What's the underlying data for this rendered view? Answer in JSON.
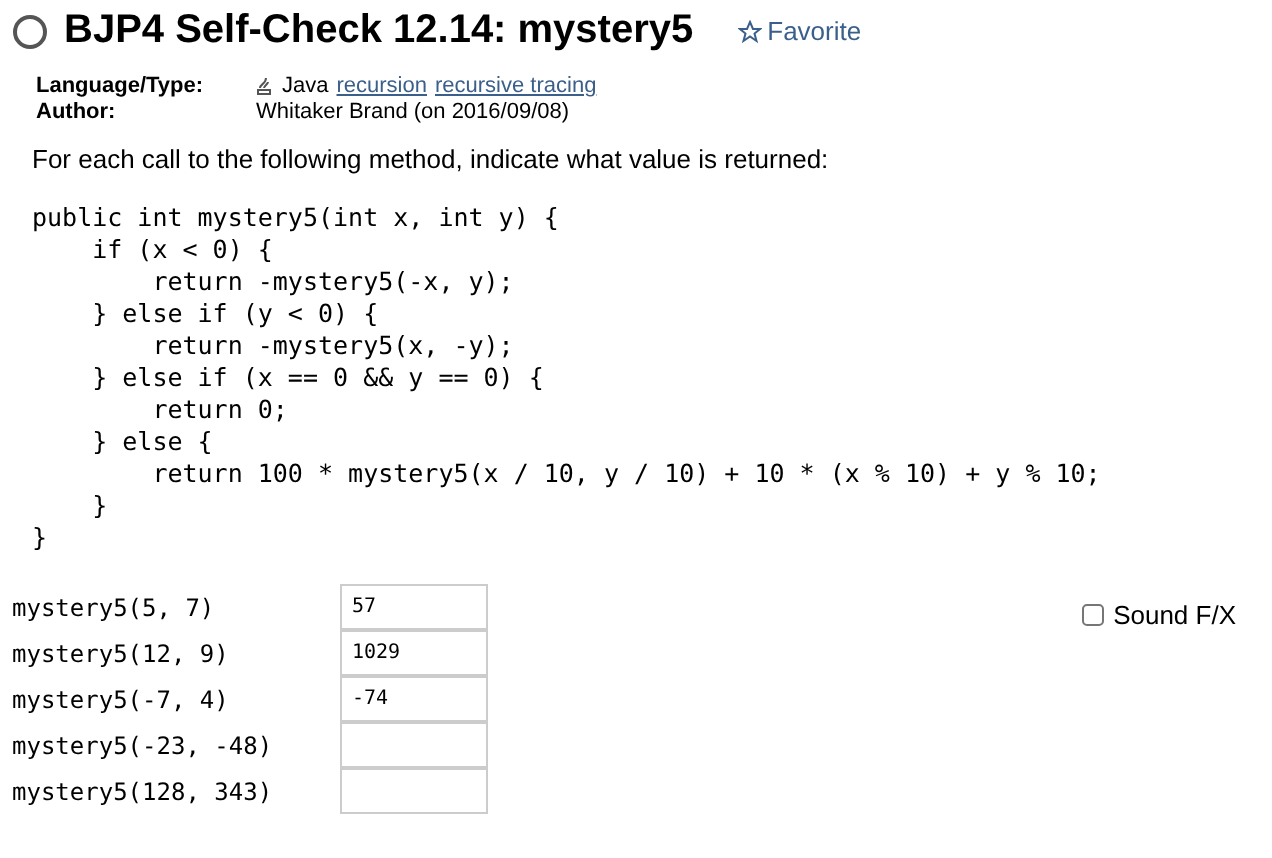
{
  "header": {
    "title": "BJP4 Self-Check 12.14: mystery5",
    "favorite": "Favorite"
  },
  "meta": [
    {
      "label": "Language/Type:",
      "value": "Java",
      "links": [
        "recursion",
        "recursive tracing"
      ]
    },
    {
      "label": "Author:",
      "value": "Whitaker Brand (on 2016/09/08)"
    }
  ],
  "prompt": "For each call to the following method, indicate what value is returned:",
  "code_lines": [
    "public int mystery5(int x, int y) {",
    "    if (x < 0) {",
    "        return -mystery5(-x, y);",
    "    } else if (y < 0) {",
    "        return -mystery5(x, -y);",
    "    } else if (x == 0 && y == 0) {",
    "        return 0;",
    "    } else {",
    "        return 100 * mystery5(x / 10, y / 10) + 10 * (x % 10) + y % 10;",
    "    }",
    "}"
  ],
  "questions": [
    {
      "call": "mystery5(5, 7)",
      "answer": "57"
    },
    {
      "call": "mystery5(12, 9)",
      "answer": "1029"
    },
    {
      "call": "mystery5(-7, 4)",
      "answer": "-74"
    },
    {
      "call": "mystery5(-23, -48)"
    },
    {
      "call": "mystery5(128, 343)"
    }
  ],
  "sound": {
    "label": "Sound F/X",
    "checked": false
  }
}
